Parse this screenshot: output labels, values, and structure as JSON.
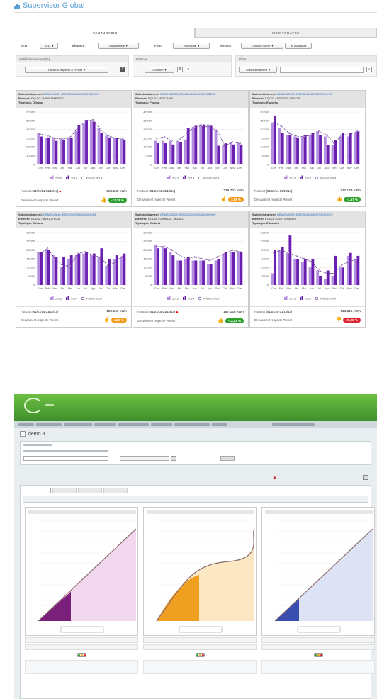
{
  "app": {
    "title": "Supervisor Global"
  },
  "tabs": [
    {
      "label": "Facturació"
    },
    {
      "label": "Monitoratge"
    }
  ],
  "filters": {
    "any_label": "Any",
    "any_value": "2014",
    "element_label": "Element",
    "element_value": "Equipament",
    "font_label": "Font",
    "font_value": "Electricitat",
    "mesura_label": "Mesura",
    "mesura_value": "Consum (kWh)",
    "update_label": "Actualitza"
  },
  "panels": {
    "analisi": {
      "title": "Anàlisi Desviament (%)",
      "select": "Facturat respecte a Previst"
    },
    "ordenar": {
      "title": "Ordenar",
      "select": "Consum"
    },
    "filtrar": {
      "title": "Filtrar",
      "select": "Subministrament"
    }
  },
  "card_labels": {
    "subministrament": "Subministrament:",
    "element": "Element:",
    "tipologia": "Tipologia:",
    "facturat": "Facturat",
    "desviament": "Desviament respecte Previst"
  },
  "legend": {
    "s2013": "2013",
    "s2014": "2014",
    "previst": "Previst 2014"
  },
  "months": [
    "Gen",
    "Feb",
    "Mar",
    "Abr",
    "Mai",
    "Jun",
    "Jul",
    "Ago",
    "Set",
    "Oct",
    "Nov",
    "Des"
  ],
  "colors": {
    "c2013": "#b48ee0",
    "c2014": "#6a1fb0",
    "previst": "#5a2a8a",
    "green": "#2e9e2e",
    "orange": "#f39a1c",
    "red": "#d9232e"
  },
  "cards": [
    {
      "subministrament": "DEM2023651; ES0031408063535001GJOF",
      "element": "EQU02 / AYUNTAMIENTO",
      "tipologia": "Oficina",
      "period": "(01/01/14-31/12/14)",
      "warn": true,
      "kwh": "353.238 kWh",
      "deviation": "-17,26 %",
      "status": "good"
    },
    {
      "subministrament": "DEM2023553; ES0031408126283001DZOF",
      "element": "EQU01 / PISCINAS",
      "tipologia": "Piscina",
      "period": "(01/01/14-31/12/14)",
      "warn": false,
      "kwh": "279.702 kWh",
      "deviation": "3,58 %",
      "status": "neutral"
    },
    {
      "subministrament": "DEM2023640; ES0031405376650001YVOF",
      "element": "EQU37 / SPORTS CENTER",
      "tipologia": "Esportiu",
      "period": "(01/01/14-31/12/14)",
      "warn": false,
      "kwh": "212.173 kWh",
      "deviation": "-1,57 %",
      "status": "good"
    },
    {
      "subministrament": "DEM2023646; ES0031405390540001JOF",
      "element": "EQU42 / BIBLIOTECA",
      "tipologia": "Cultural",
      "period": "(01/01/14-31/12/14)",
      "warn": false,
      "kwh": "189.660 kWh",
      "deviation": "4,25 %",
      "status": "neutral"
    },
    {
      "subministrament": "DEM2022626; ES0031405190542001XHOF",
      "element": "EQU45 / GRANJA - MUSEO",
      "tipologia": "Cultural",
      "period": "(01/01/14-31/12/14)",
      "warn": true,
      "kwh": "187.145 kWh",
      "deviation": "-13,42 %",
      "status": "good"
    },
    {
      "subministrament": "DEM2022599; ES0031405059870002HDOF",
      "element": "EQU16 / CEIP GASPAR",
      "tipologia": "Educació",
      "period": "(01/01/14-31/12/14)",
      "warn": false,
      "kwh": "113.816 kWh",
      "deviation": "20,28 %",
      "status": "bad"
    }
  ],
  "chart_data": [
    {
      "type": "bar",
      "categories": [
        "Gen",
        "Feb",
        "Mar",
        "Abr",
        "Mai",
        "Jun",
        "Jul",
        "Ago",
        "Set",
        "Oct",
        "Nov",
        "Des"
      ],
      "ylim": [
        0,
        60000
      ],
      "yticks": [
        0,
        10000,
        20000,
        30000,
        40000,
        50000,
        60000
      ],
      "series": [
        {
          "name": "2013",
          "values": [
            36000,
            30000,
            31000,
            29000,
            31000,
            38000,
            47000,
            50000,
            42000,
            33000,
            30000,
            29000
          ]
        },
        {
          "name": "2014",
          "values": [
            32000,
            31000,
            27000,
            28000,
            30000,
            45000,
            51000,
            49000,
            36000,
            31000,
            30000,
            28000
          ]
        },
        {
          "name": "Previst 2014",
          "values": [
            35000,
            33000,
            30000,
            29000,
            31000,
            42000,
            50000,
            51000,
            40000,
            33000,
            30000,
            29000
          ]
        }
      ]
    },
    {
      "type": "bar",
      "categories": [
        "Gen",
        "Feb",
        "Mar",
        "Abr",
        "Mai",
        "Jun",
        "Jul",
        "Ago",
        "Set",
        "Oct",
        "Nov",
        "Des"
      ],
      "ylim": [
        0,
        42000
      ],
      "yticks": [
        0,
        7000,
        14000,
        21000,
        28000,
        35000,
        42000
      ],
      "series": [
        {
          "name": "2013",
          "values": [
            19000,
            19000,
            19000,
            19000,
            20000,
            30000,
            32000,
            32000,
            28000,
            16000,
            18000,
            17000
          ]
        },
        {
          "name": "2014",
          "values": [
            17000,
            17000,
            16000,
            18000,
            29000,
            31000,
            32000,
            31000,
            15000,
            17000,
            16000,
            16000
          ]
        },
        {
          "name": "Previst 2014",
          "values": [
            21000,
            22000,
            19000,
            20000,
            25000,
            30000,
            31000,
            30000,
            27000,
            15000,
            18000,
            17000
          ]
        }
      ]
    },
    {
      "type": "bar",
      "categories": [
        "Gen",
        "Feb",
        "Mar",
        "Abr",
        "Mai",
        "Jun",
        "Jul",
        "Ago",
        "Set",
        "Oct",
        "Nov",
        "Des"
      ],
      "ylim": [
        0,
        30000
      ],
      "yticks": [
        0,
        5000,
        10000,
        15000,
        20000,
        25000,
        30000
      ],
      "series": [
        {
          "name": "2013",
          "values": [
            24000,
            21000,
            17000,
            16000,
            16000,
            17000,
            19000,
            16000,
            11000,
            16000,
            16000,
            18000
          ]
        },
        {
          "name": "2014",
          "values": [
            28000,
            18000,
            17000,
            15000,
            17000,
            18000,
            17000,
            11000,
            14000,
            18000,
            18000,
            19000
          ]
        },
        {
          "name": "Previst 2014",
          "values": [
            24000,
            22000,
            18000,
            16000,
            16000,
            17000,
            19000,
            17000,
            12000,
            17000,
            17000,
            19000
          ]
        }
      ]
    },
    {
      "type": "bar",
      "categories": [
        "Gen",
        "Feb",
        "Mar",
        "Abr",
        "Mai",
        "Jun",
        "Jul",
        "Ago",
        "Set",
        "Oct",
        "Nov",
        "Des"
      ],
      "ylim": [
        0,
        30000
      ],
      "yticks": [
        0,
        5000,
        10000,
        15000,
        20000,
        25000,
        30000
      ],
      "series": [
        {
          "name": "2013",
          "values": [
            19000,
            20000,
            17000,
            10000,
            15000,
            17000,
            18000,
            17000,
            16000,
            11000,
            15000,
            16000
          ]
        },
        {
          "name": "2014",
          "values": [
            19000,
            20000,
            16000,
            16000,
            17000,
            18000,
            19000,
            18000,
            21000,
            15000,
            17000,
            18000
          ]
        },
        {
          "name": "Previst 2014",
          "values": [
            18000,
            21000,
            15000,
            11000,
            11000,
            18000,
            19000,
            17000,
            16000,
            11000,
            13000,
            17000
          ]
        }
      ]
    },
    {
      "type": "bar",
      "categories": [
        "Gen",
        "Feb",
        "Mar",
        "Abr",
        "Mai",
        "Jun",
        "Jul",
        "Ago",
        "Set",
        "Oct",
        "Nov",
        "Des"
      ],
      "ylim": [
        0,
        30000
      ],
      "yticks": [
        0,
        5000,
        10000,
        15000,
        20000,
        25000,
        30000
      ],
      "series": [
        {
          "name": "2013",
          "values": [
            23000,
            22000,
            19000,
            14000,
            15000,
            14000,
            14000,
            12000,
            14000,
            18000,
            19000,
            19000
          ]
        },
        {
          "name": "2014",
          "values": [
            21000,
            21000,
            17000,
            14000,
            16000,
            14000,
            14000,
            12000,
            15000,
            19000,
            19000,
            19000
          ]
        },
        {
          "name": "Previst 2014",
          "values": [
            22000,
            22000,
            20000,
            17000,
            15000,
            16000,
            15000,
            14000,
            16000,
            18000,
            20000,
            19000
          ]
        }
      ]
    },
    {
      "type": "bar",
      "categories": [
        "Gen",
        "Feb",
        "Mar",
        "Abr",
        "Mai",
        "Jun",
        "Jul",
        "Ago",
        "Set",
        "Oct",
        "Nov",
        "Des"
      ],
      "ylim": [
        0,
        18000
      ],
      "yticks": [
        0,
        3000,
        6000,
        9000,
        12000,
        15000,
        18000
      ],
      "series": [
        {
          "name": "2013",
          "values": [
            4000,
            12000,
            11000,
            9000,
            8000,
            6000,
            5000,
            2000,
            3000,
            6000,
            10000,
            9000
          ]
        },
        {
          "name": "2014",
          "values": [
            12000,
            13000,
            17000,
            9000,
            9000,
            9000,
            3000,
            5000,
            10000,
            6000,
            11000,
            10000
          ]
        },
        {
          "name": "Previst 2014",
          "values": [
            11000,
            12000,
            11000,
            10000,
            9000,
            8000,
            5000,
            4000,
            4000,
            7000,
            8000,
            9000
          ]
        }
      ]
    }
  ],
  "lower_app": {
    "title": "demo 3"
  }
}
